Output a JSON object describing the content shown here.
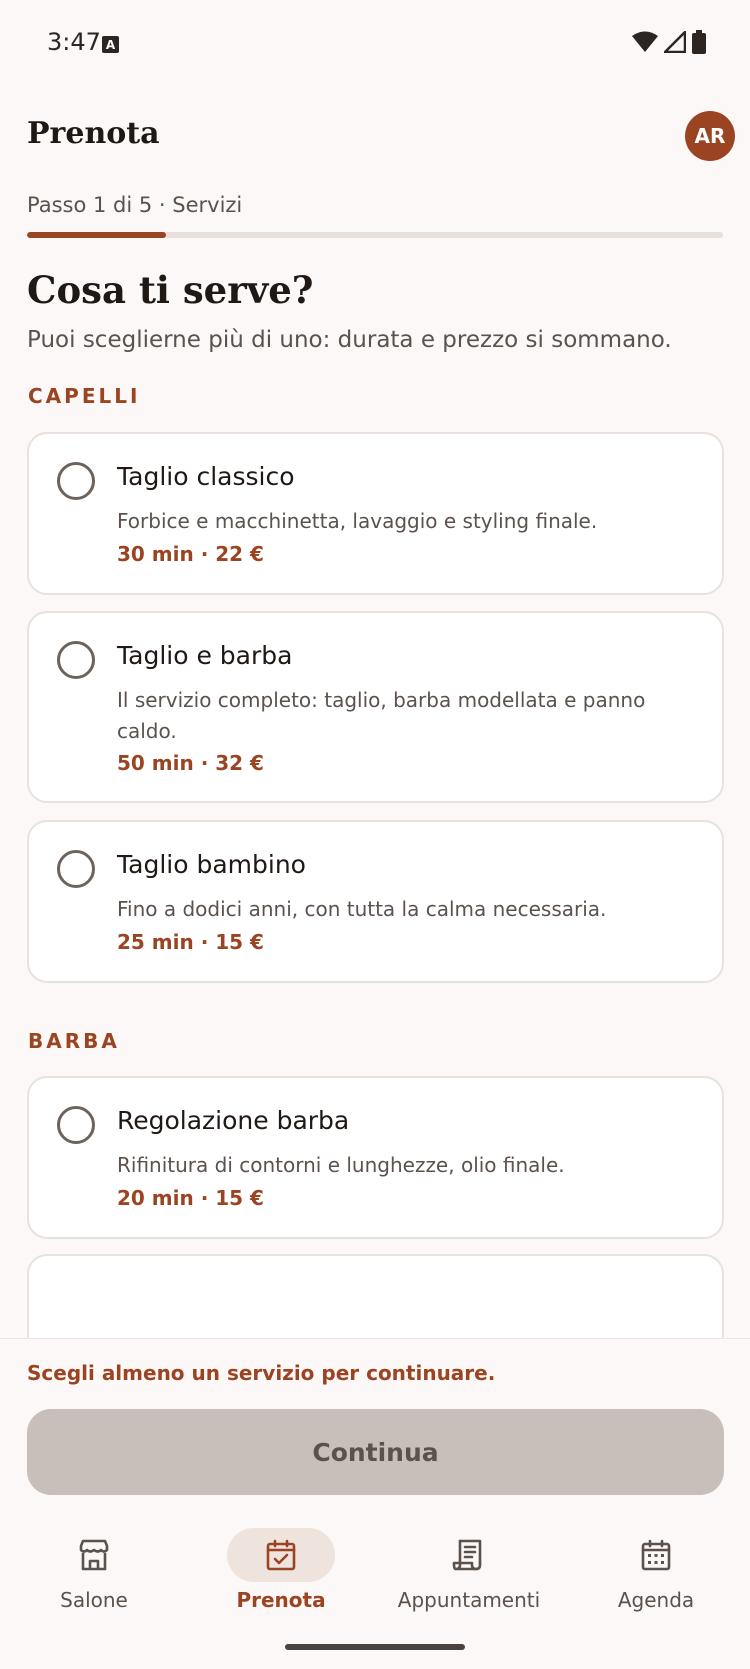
{
  "status": {
    "time": "3:47"
  },
  "header": {
    "title": "Prenota",
    "avatar_initials": "AR"
  },
  "progress": {
    "label": "Passo 1 di 5 · Servizi",
    "current_step": 1,
    "total_steps": 5,
    "fraction": 0.2
  },
  "intro": {
    "heading": "Cosa ti serve?",
    "subheading": "Puoi sceglierne più di uno: durata e prezzo si sommano."
  },
  "sections": [
    {
      "title": "CAPELLI",
      "services": [
        {
          "name": "Taglio classico",
          "description": "Forbice e macchinetta, lavaggio e styling finale.",
          "meta": "30 min · 22 €",
          "selected": false
        },
        {
          "name": "Taglio e barba",
          "description": "Il servizio completo: taglio, barba modellata e panno caldo.",
          "meta": "50 min · 32 €",
          "selected": false
        },
        {
          "name": "Taglio bambino",
          "description": "Fino a dodici anni, con tutta la calma necessaria.",
          "meta": "25 min · 15 €",
          "selected": false
        }
      ]
    },
    {
      "title": "BARBA",
      "services": [
        {
          "name": "Regolazione barba",
          "description": "Rifinitura di contorni e lunghezze, olio finale.",
          "meta": "20 min · 15 €",
          "selected": false
        }
      ]
    }
  ],
  "footer": {
    "hint": "Scegli almeno un servizio per continuare.",
    "continue_label": "Continua"
  },
  "nav": [
    {
      "label": "Salone",
      "icon": "storefront-icon",
      "active": false
    },
    {
      "label": "Prenota",
      "icon": "calendar-check-icon",
      "active": true
    },
    {
      "label": "Appuntamenti",
      "icon": "receipt-icon",
      "active": false
    },
    {
      "label": "Agenda",
      "icon": "calendar-grid-icon",
      "active": false
    }
  ],
  "colors": {
    "accent": "#9a4422",
    "background": "#fbf8f7",
    "card": "#ffffff",
    "disabled_button": "#c8bfba"
  }
}
